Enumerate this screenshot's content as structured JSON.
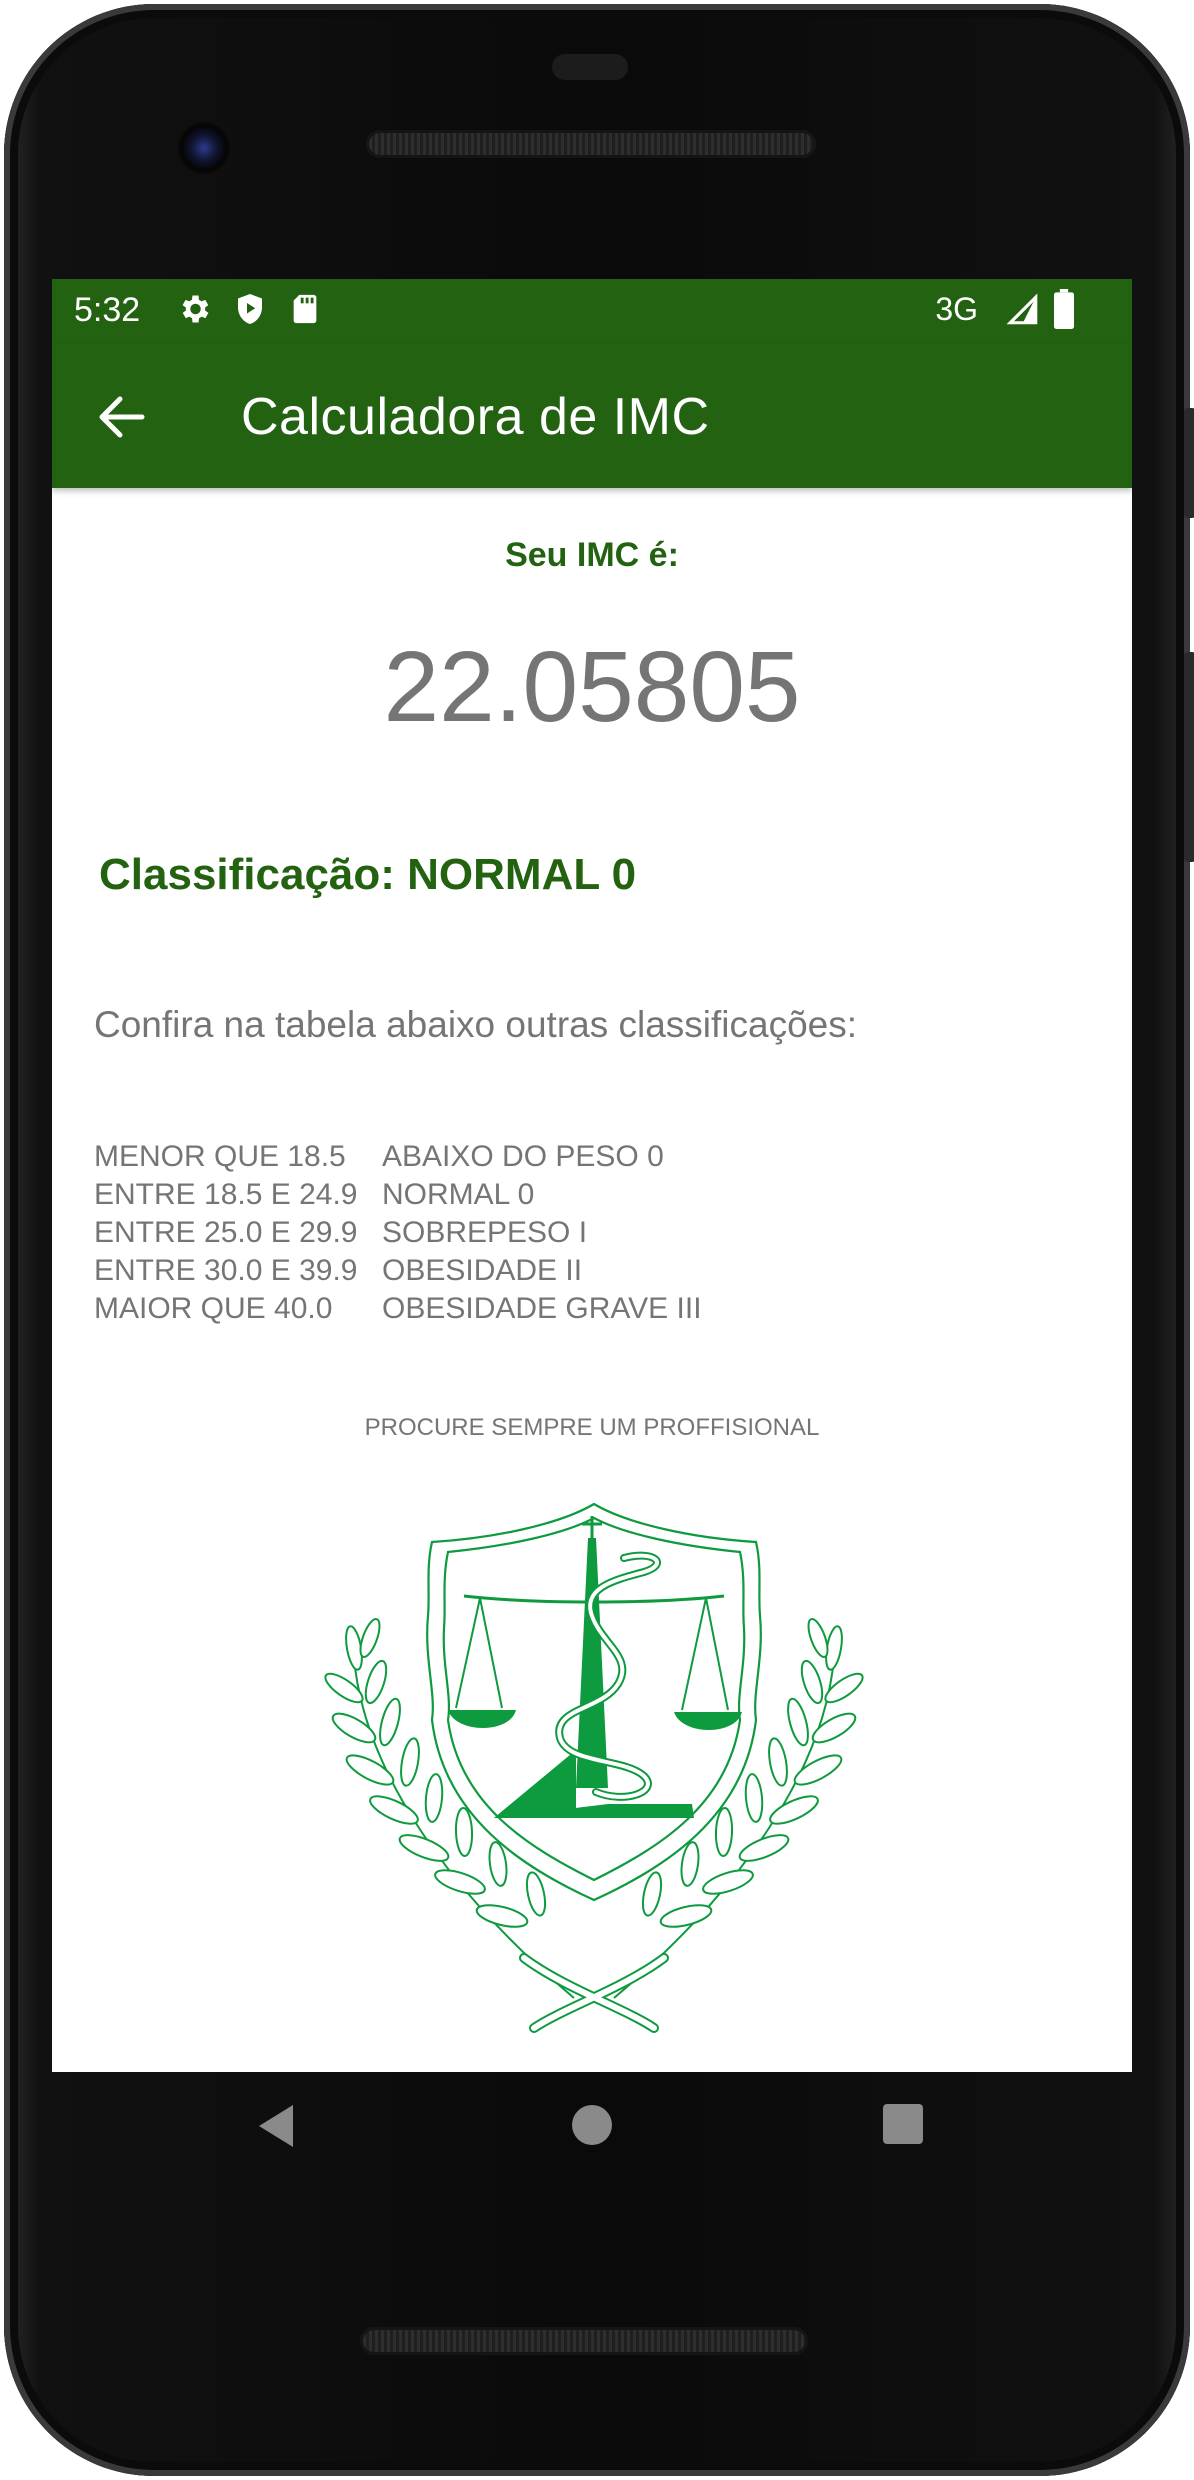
{
  "status_bar": {
    "time": "5:32",
    "icons": [
      "gear-icon",
      "shield-play-icon",
      "sd-card-icon"
    ],
    "network": "3G",
    "right_icons": [
      "signal-icon",
      "battery-icon"
    ]
  },
  "app_bar": {
    "title": "Calculadora de IMC",
    "back_icon": "arrow-back-icon"
  },
  "result": {
    "label": "Seu IMC é:",
    "value": "22.05805",
    "classification": "Classificação: NORMAL 0"
  },
  "table_intro": "Confira na tabela abaixo outras classificações:",
  "table": [
    {
      "range": "MENOR QUE 18.5",
      "category": "ABAIXO DO PESO 0"
    },
    {
      "range": "ENTRE 18.5 E 24.9",
      "category": "NORMAL 0"
    },
    {
      "range": "ENTRE 25.0 E 29.9",
      "category": "SOBREPESO I"
    },
    {
      "range": "ENTRE 30.0 E 39.9",
      "category": "OBESIDADE II"
    },
    {
      "range": "MAIOR QUE 40.0",
      "category": "OBESIDADE GRAVE III"
    }
  ],
  "footer_note": "PROCURE SEMPRE UM PROFFISIONAL",
  "emblem_icon": "medical-law-emblem-icon",
  "nav_bar": {
    "back": "nav-back-icon",
    "home": "nav-home-icon",
    "recents": "nav-recents-icon"
  },
  "colors": {
    "primary": "#236211",
    "text_gray": "#757575",
    "emblem_green": "#0e9a3e"
  }
}
